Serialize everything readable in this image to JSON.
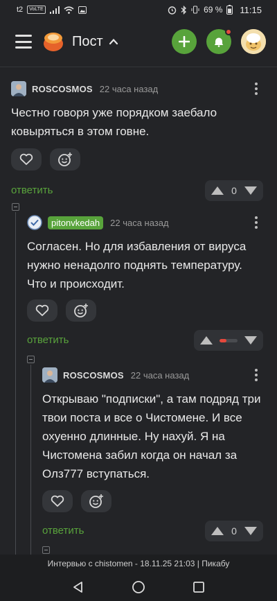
{
  "status_bar": {
    "carrier": "t2",
    "volte": "VoLTE",
    "battery": "69 %",
    "time": "11:15"
  },
  "header": {
    "title": "Пост",
    "add_icon": "plus-icon",
    "bell_icon": "bell-icon",
    "accent": "#58a33b"
  },
  "comments": [
    {
      "author": "ROSCOSMOS",
      "time": "22 часа назад",
      "text": "Честно говоря уже порядком заебало ковыряться в этом говне.",
      "reply_label": "ответить",
      "votes": "0"
    },
    {
      "author": "pitonvkedah",
      "time": "22 часа назад",
      "text": "Согласен. Но для избавления от вируса нужно ненадолго поднять температуру. Что и происходит.",
      "reply_label": "ответить",
      "vote_bar_fraction": 0.4
    },
    {
      "author": "ROSCOSMOS",
      "time": "22 часа назад",
      "text": "Открываю \"подписки\", а там подряд три твои поста и все о Чистомене. И все охуенно длинные. Ну нахуй. Я на Чистомена забил когда он начал за Олз777 вступаться.",
      "reply_label": "ответить",
      "votes": "0"
    }
  ],
  "banner": {
    "text": "Интервью с chistomen - 18.11.25 21:03 | Пикабу"
  },
  "colors": {
    "background": "#232427",
    "reply_green": "#59a33c",
    "downvote_red": "#e5483c"
  }
}
